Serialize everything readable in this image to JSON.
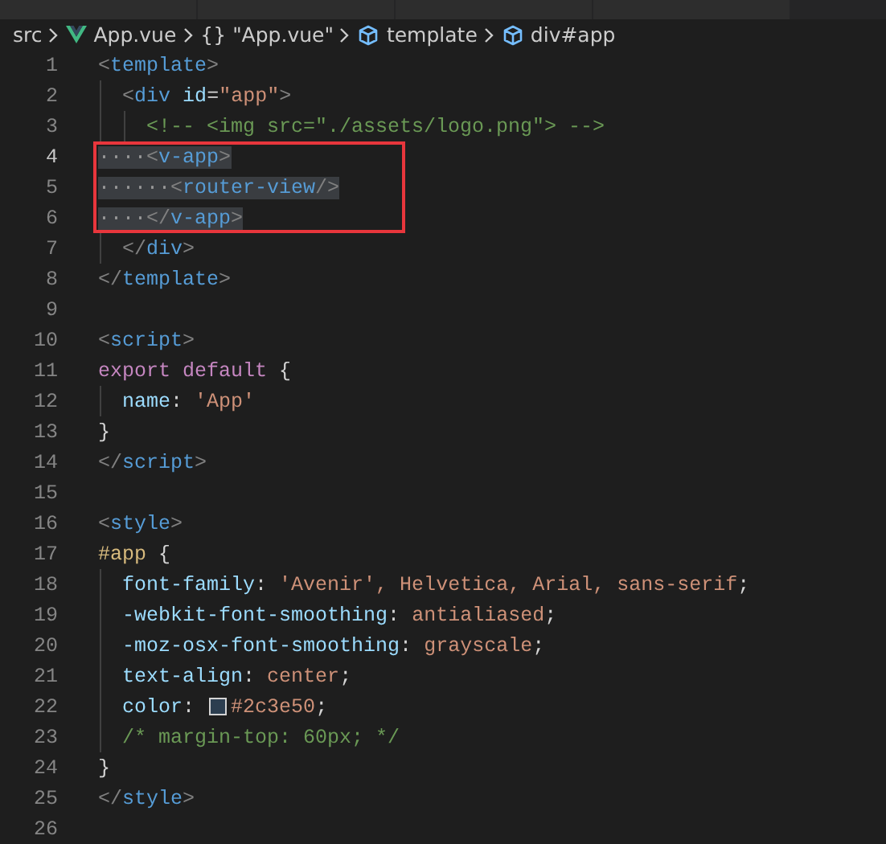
{
  "tabs": [
    {
      "selected": false
    },
    {
      "selected": false
    },
    {
      "selected": false
    },
    {
      "selected": false
    }
  ],
  "breadcrumb": [
    {
      "kind": "folder",
      "label": "src"
    },
    {
      "kind": "vue",
      "label": "App.vue"
    },
    {
      "kind": "object",
      "icon": "{}",
      "label": "\"App.vue\""
    },
    {
      "kind": "element",
      "label": "template"
    },
    {
      "kind": "element",
      "label": "div#app"
    }
  ],
  "lines": [
    {
      "number": "1",
      "active": false,
      "selected": false,
      "tokens": [
        {
          "kind": "bracket",
          "text": "<"
        },
        {
          "kind": "tag",
          "text": "template"
        },
        {
          "kind": "bracket",
          "text": ">"
        }
      ]
    },
    {
      "number": "2",
      "active": false,
      "selected": false,
      "tokens": [
        {
          "kind": "bracket",
          "text": "  <"
        },
        {
          "kind": "tag",
          "text": "div"
        },
        {
          "kind": "attr",
          "text": " id"
        },
        {
          "kind": "plain",
          "text": "="
        },
        {
          "kind": "string",
          "text": "\"app\""
        },
        {
          "kind": "bracket",
          "text": ">"
        }
      ]
    },
    {
      "number": "3",
      "active": false,
      "selected": false,
      "tokens": [
        {
          "kind": "comment",
          "text": "    <!-- <img src=\"./assets/logo.png\"> -->"
        }
      ]
    },
    {
      "number": "4",
      "active": true,
      "selected": true,
      "tokens": [
        {
          "kind": "space",
          "text": "····"
        },
        {
          "kind": "bracket",
          "text": "<"
        },
        {
          "kind": "tag",
          "text": "v-app"
        },
        {
          "kind": "bracket",
          "text": ">"
        }
      ]
    },
    {
      "number": "5",
      "active": false,
      "selected": true,
      "tokens": [
        {
          "kind": "space",
          "text": "······"
        },
        {
          "kind": "bracket",
          "text": "<"
        },
        {
          "kind": "tag",
          "text": "router-view"
        },
        {
          "kind": "bracket",
          "text": "/>"
        }
      ]
    },
    {
      "number": "6",
      "active": false,
      "selected": true,
      "tokens": [
        {
          "kind": "space",
          "text": "····"
        },
        {
          "kind": "bracket",
          "text": "</"
        },
        {
          "kind": "tag",
          "text": "v-app"
        },
        {
          "kind": "bracket",
          "text": ">"
        }
      ]
    },
    {
      "number": "7",
      "active": false,
      "selected": false,
      "tokens": [
        {
          "kind": "bracket",
          "text": "  </"
        },
        {
          "kind": "tag",
          "text": "div"
        },
        {
          "kind": "bracket",
          "text": ">"
        }
      ]
    },
    {
      "number": "8",
      "active": false,
      "selected": false,
      "tokens": [
        {
          "kind": "bracket",
          "text": "</"
        },
        {
          "kind": "tag",
          "text": "template"
        },
        {
          "kind": "bracket",
          "text": ">"
        }
      ]
    },
    {
      "number": "9",
      "active": false,
      "selected": false
    },
    {
      "number": "10",
      "active": false,
      "selected": false,
      "tokens": [
        {
          "kind": "bracket",
          "text": "<"
        },
        {
          "kind": "tag",
          "text": "script"
        },
        {
          "kind": "bracket",
          "text": ">"
        }
      ]
    },
    {
      "number": "11",
      "active": false,
      "selected": false,
      "tokens": [
        {
          "kind": "keyword",
          "text": "export default"
        },
        {
          "kind": "plain",
          "text": " {"
        }
      ]
    },
    {
      "number": "12",
      "active": false,
      "selected": false,
      "tokens": [
        {
          "kind": "attr",
          "text": "  name"
        },
        {
          "kind": "plain",
          "text": ": "
        },
        {
          "kind": "string",
          "text": "'App'"
        }
      ]
    },
    {
      "number": "13",
      "active": false,
      "selected": false,
      "tokens": [
        {
          "kind": "plain",
          "text": "}"
        }
      ]
    },
    {
      "number": "14",
      "active": false,
      "selected": false,
      "tokens": [
        {
          "kind": "bracket",
          "text": "</"
        },
        {
          "kind": "tag",
          "text": "script"
        },
        {
          "kind": "bracket",
          "text": ">"
        }
      ]
    },
    {
      "number": "15",
      "active": false,
      "selected": false
    },
    {
      "number": "16",
      "active": false,
      "selected": false,
      "tokens": [
        {
          "kind": "bracket",
          "text": "<"
        },
        {
          "kind": "tag",
          "text": "style"
        },
        {
          "kind": "bracket",
          "text": ">"
        }
      ]
    },
    {
      "number": "17",
      "active": false,
      "selected": false,
      "tokens": [
        {
          "kind": "selector",
          "text": "#app"
        },
        {
          "kind": "plain",
          "text": " {"
        }
      ]
    },
    {
      "number": "18",
      "active": false,
      "selected": false,
      "tokens": [
        {
          "kind": "attr",
          "text": "  font-family"
        },
        {
          "kind": "plain",
          "text": ": "
        },
        {
          "kind": "string",
          "text": "'Avenir', Helvetica, Arial, sans-serif"
        },
        {
          "kind": "plain",
          "text": ";"
        }
      ]
    },
    {
      "number": "19",
      "active": false,
      "selected": false,
      "tokens": [
        {
          "kind": "attr",
          "text": "  -webkit-font-smoothing"
        },
        {
          "kind": "plain",
          "text": ": "
        },
        {
          "kind": "string",
          "text": "antialiased"
        },
        {
          "kind": "plain",
          "text": ";"
        }
      ]
    },
    {
      "number": "20",
      "active": false,
      "selected": false,
      "tokens": [
        {
          "kind": "attr",
          "text": "  -moz-osx-font-smoothing"
        },
        {
          "kind": "plain",
          "text": ": "
        },
        {
          "kind": "string",
          "text": "grayscale"
        },
        {
          "kind": "plain",
          "text": ";"
        }
      ]
    },
    {
      "number": "21",
      "active": false,
      "selected": false,
      "tokens": [
        {
          "kind": "attr",
          "text": "  text-align"
        },
        {
          "kind": "plain",
          "text": ": "
        },
        {
          "kind": "string",
          "text": "center"
        },
        {
          "kind": "plain",
          "text": ";"
        }
      ]
    },
    {
      "number": "22",
      "active": false,
      "selected": false,
      "tokens": [
        {
          "kind": "attr",
          "text": "  color"
        },
        {
          "kind": "plain",
          "text": ": "
        },
        {
          "kind": "swatch",
          "color": "#2c3e50"
        },
        {
          "kind": "string",
          "text": "#2c3e50"
        },
        {
          "kind": "plain",
          "text": ";"
        }
      ]
    },
    {
      "number": "23",
      "active": false,
      "selected": false,
      "tokens": [
        {
          "kind": "comment",
          "text": "  /* margin-top: 60px; */"
        }
      ]
    },
    {
      "number": "24",
      "active": false,
      "selected": false,
      "tokens": [
        {
          "kind": "plain",
          "text": "}"
        }
      ]
    },
    {
      "number": "25",
      "active": false,
      "selected": false,
      "tokens": [
        {
          "kind": "bracket",
          "text": "</"
        },
        {
          "kind": "tag",
          "text": "style"
        },
        {
          "kind": "bracket",
          "text": ">"
        }
      ]
    },
    {
      "number": "26",
      "active": false,
      "selected": false
    }
  ]
}
